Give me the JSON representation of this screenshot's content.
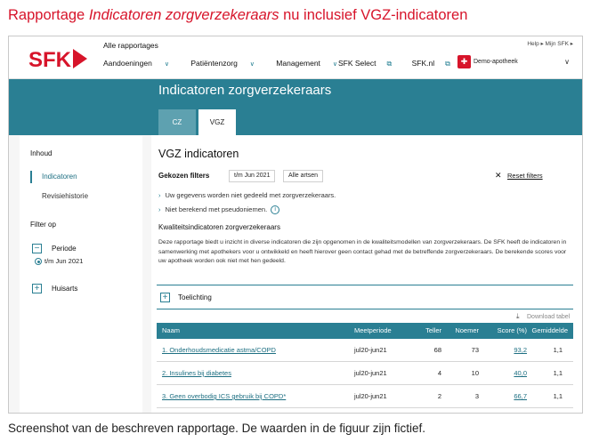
{
  "caption": {
    "title_part1": "Rapportage ",
    "title_italic": "Indicatoren zorgverzekeraars",
    "title_part2": " nu inclusief VGZ-indicatoren",
    "footer": "Screenshot van de beschreven rapportage. De waarden in de figuur zijn fictief."
  },
  "header": {
    "logo_text": "SFK",
    "all_reports": "Alle rapportages",
    "nav": [
      "Aandoeningen",
      "Patiëntenzorg",
      "Management"
    ],
    "nav_external": [
      "SFK Select",
      "SFK.nl"
    ],
    "help_links": "Help ▸   Mijn SFK ▸",
    "pharmacy": "Demo-apotheek",
    "colors": {
      "brand_red": "#d7142a",
      "teal": "#2a7f93"
    }
  },
  "band": {
    "title": "Indicatoren zorgverzekeraars",
    "tabs": [
      {
        "label": "CZ",
        "active": false
      },
      {
        "label": "VGZ",
        "active": true
      }
    ]
  },
  "sidebar": {
    "content_heading": "Inhoud",
    "items": [
      {
        "label": "Indicatoren",
        "active": true
      },
      {
        "label": "Revisiehistorie",
        "active": false
      }
    ],
    "filter_heading": "Filter op",
    "period_label": "Periode",
    "period_option": "t/m Jun 2021",
    "gp_label": "Huisarts"
  },
  "main": {
    "title": "VGZ indicatoren",
    "chosen_filters_label": "Gekozen filters",
    "chips": [
      "t/m Jun 2021",
      "Alle artsen"
    ],
    "reset_label": "Reset filters",
    "info_lines": [
      "Uw gegevens worden niet gedeeld met zorgverzekeraars.",
      "Niet berekend met pseudoniemen."
    ],
    "info_icon": "i",
    "kwal_heading": "Kwaliteitsindicatoren zorgverzekeraars",
    "description": "Deze rapportage biedt u inzicht in diverse indicatoren die zijn opgenomen in de kwaliteitsmodellen van zorgverzekeraars. De SFK heeft de indicatoren in samenwerking met apothekers voor u ontwikkeld en heeft hierover geen contact gehad met de betreffende zorgverzekeraars. De berekende scores voor uw apotheek worden ook niet met hen gedeeld.",
    "toelichting_label": "Toelichting",
    "download_label": "Download tabel"
  },
  "table": {
    "headers": [
      "Naam",
      "Meetperiode",
      "Teller",
      "Noemer",
      "Score (%)",
      "Gemiddelde"
    ],
    "rows": [
      {
        "naam": "1. Onderhoudsmedicatie astma/COPD",
        "meetperiode": "jul20-jun21",
        "teller": "68",
        "noemer": "73",
        "score": "93,2",
        "gemiddelde": "1,1"
      },
      {
        "naam": "2. Insulines bij diabetes",
        "meetperiode": "jul20-jun21",
        "teller": "4",
        "noemer": "10",
        "score": "40,0",
        "gemiddelde": "1,1"
      },
      {
        "naam": "3. Geen overbodig ICS gebruik bij COPD*",
        "meetperiode": "jul20-jun21",
        "teller": "2",
        "noemer": "3",
        "score": "66,7",
        "gemiddelde": "1,1"
      }
    ]
  }
}
